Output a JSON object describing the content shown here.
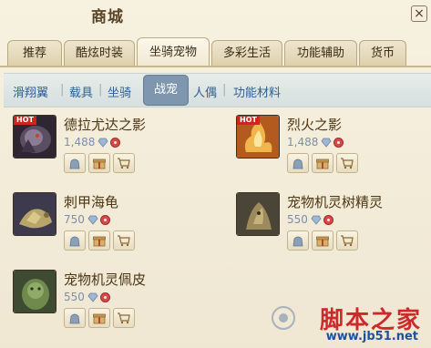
{
  "window": {
    "title": "商城"
  },
  "tabs": [
    {
      "label": "推荐"
    },
    {
      "label": "酷炫时装"
    },
    {
      "label": "坐骑宠物"
    },
    {
      "label": "多彩生活"
    },
    {
      "label": "功能辅助"
    },
    {
      "label": "货币"
    }
  ],
  "subnav": [
    {
      "label": "滑翔翼"
    },
    {
      "label": "载具"
    },
    {
      "label": "坐骑"
    },
    {
      "label": "战宠"
    },
    {
      "label": "人偶"
    },
    {
      "label": "功能材料"
    }
  ],
  "items": [
    {
      "name": "德拉尤达之影",
      "price": "1,488",
      "hot_label": "HOT"
    },
    {
      "name": "烈火之影",
      "price": "1,488",
      "hot_label": "HOT"
    },
    {
      "name": "刺甲海龟",
      "price": "750"
    },
    {
      "name": "宠物机灵树精灵",
      "price": "550"
    },
    {
      "name": "宠物机灵佩皮",
      "price": "550"
    }
  ],
  "watermark": {
    "brand": "脚本之家",
    "url": "www.jb51.net"
  },
  "colors": {
    "accent": "#7e96ae",
    "hot": "#c8281d",
    "price": "#7b8fa9"
  },
  "icons": [
    "close-icon",
    "gem-icon",
    "coupon-icon",
    "bag-icon",
    "gift-icon",
    "cart-icon"
  ]
}
